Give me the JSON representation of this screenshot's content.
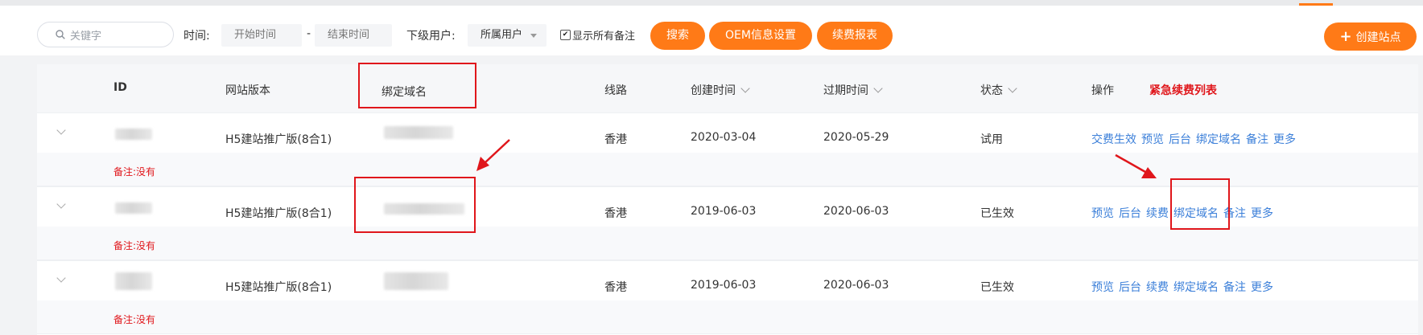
{
  "toolbar": {
    "search_placeholder": "关键字",
    "time_label": "时间:",
    "start_placeholder": "开始时间",
    "range_sep": "-",
    "end_placeholder": "结束时间",
    "sub_user_label": "下级用户:",
    "sub_user_value": "所属用户",
    "show_notes_label": "显示所有备注",
    "search_button": "搜索",
    "oem_button": "OEM信息设置",
    "renew_report_button": "续费报表",
    "create_site_button": "创建站点",
    "create_site_icon": "+"
  },
  "table": {
    "headers": {
      "id": "ID",
      "version": "网站版本",
      "domain": "绑定域名",
      "line": "线路",
      "created": "创建时间",
      "expires": "过期时间",
      "status": "状态",
      "actions": "操作",
      "urgent": "紧急续费列表"
    },
    "rows": [
      {
        "version": "H5建站推广版(8合1)",
        "line": "香港",
        "created": "2020-03-04",
        "expires": "2020-05-29",
        "status": "试用",
        "note": "备注:没有",
        "actions": [
          "交费生效",
          "预览",
          "后台",
          "绑定域名",
          "备注",
          "更多"
        ]
      },
      {
        "version": "H5建站推广版(8合1)",
        "line": "香港",
        "created": "2019-06-03",
        "expires": "2020-06-03",
        "status": "已生效",
        "note": "备注:没有",
        "actions": [
          "预览",
          "后台",
          "续费",
          "绑定域名",
          "备注",
          "更多"
        ]
      },
      {
        "version": "H5建站推广版(8合1)",
        "line": "香港",
        "created": "2019-06-03",
        "expires": "2020-06-03",
        "status": "已生效",
        "note": "备注:没有",
        "actions": [
          "预览",
          "后台",
          "续费",
          "绑定域名",
          "备注",
          "更多"
        ]
      }
    ]
  },
  "colors": {
    "accent": "#ff7a17",
    "link": "#3b7fd9",
    "annotation_red": "#e0161b"
  }
}
